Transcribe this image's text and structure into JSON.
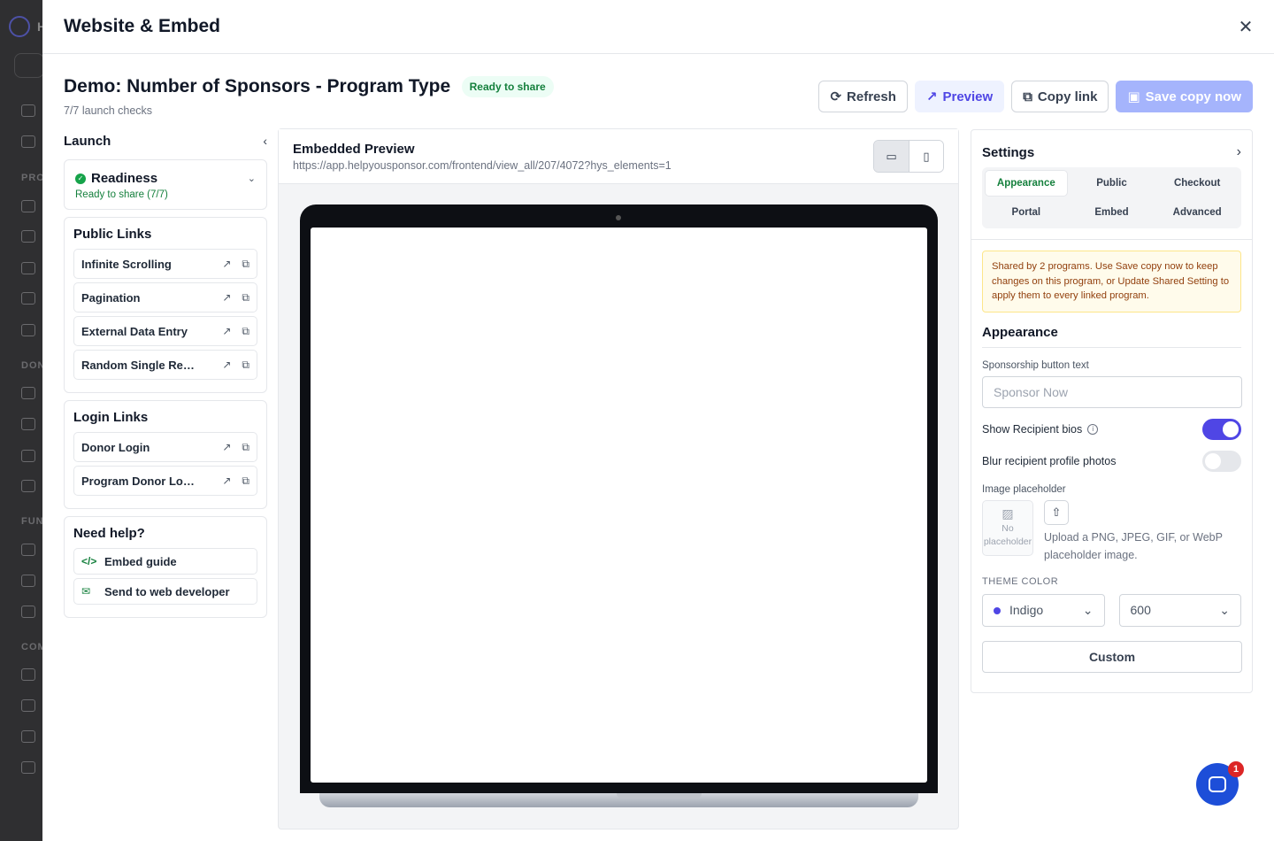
{
  "background": {
    "app_letter": "H",
    "section_labels": [
      "PRO",
      "DON",
      "FUN",
      "COM"
    ]
  },
  "modal": {
    "title": "Website & Embed",
    "close_icon": "close-icon"
  },
  "program": {
    "title": "Demo: Number of Sponsors - Program Type",
    "status_badge": "Ready to share",
    "launch_checks": "7/7 launch checks"
  },
  "actions": {
    "refresh": "Refresh",
    "preview": "Preview",
    "copy_link": "Copy link",
    "save_copy": "Save copy now"
  },
  "launch": {
    "title": "Launch",
    "readiness_title": "Readiness",
    "readiness_sub": "Ready to share (7/7)",
    "public_links_title": "Public Links",
    "public_links": [
      {
        "label": "Infinite Scrolling"
      },
      {
        "label": "Pagination"
      },
      {
        "label": "External Data Entry"
      },
      {
        "label": "Random Single Reci..."
      }
    ],
    "login_links_title": "Login Links",
    "login_links": [
      {
        "label": "Donor Login"
      },
      {
        "label": "Program Donor Login"
      }
    ],
    "help_title": "Need help?",
    "help_items": [
      {
        "label": "Embed guide",
        "icon": "</>"
      },
      {
        "label": "Send to web developer",
        "icon": "✉"
      }
    ]
  },
  "preview_panel": {
    "title": "Embedded Preview",
    "url": "https://app.helpyousponsor.com/frontend/view_all/207/4072?hys_elements=1",
    "device_active": "desktop"
  },
  "settings": {
    "title": "Settings",
    "tabs": [
      {
        "label": "Appearance",
        "active": true
      },
      {
        "label": "Public",
        "active": false
      },
      {
        "label": "Checkout",
        "active": false
      },
      {
        "label": "Portal",
        "active": false
      },
      {
        "label": "Embed",
        "active": false
      },
      {
        "label": "Advanced",
        "active": false
      }
    ],
    "notice": "Shared by 2 programs. Use Save copy now to keep changes on this program, or Update Shared Setting to apply them to every linked program.",
    "section_title": "Appearance",
    "sponsor_button_label": "Sponsorship button text",
    "sponsor_button_placeholder": "Sponsor Now",
    "show_bios_label": "Show Recipient bios",
    "show_bios": true,
    "blur_photos_label": "Blur recipient profile photos",
    "blur_photos": false,
    "image_placeholder_label": "Image placeholder",
    "no_placeholder": "No placeholder",
    "upload_help": "Upload a PNG, JPEG, GIF, or WebP placeholder image.",
    "theme_color_label": "THEME COLOR",
    "theme_color": "Indigo",
    "theme_color_hex": "#4f46e5",
    "theme_shade": "600",
    "custom_button": "Custom"
  },
  "chat": {
    "badge_count": "1"
  }
}
